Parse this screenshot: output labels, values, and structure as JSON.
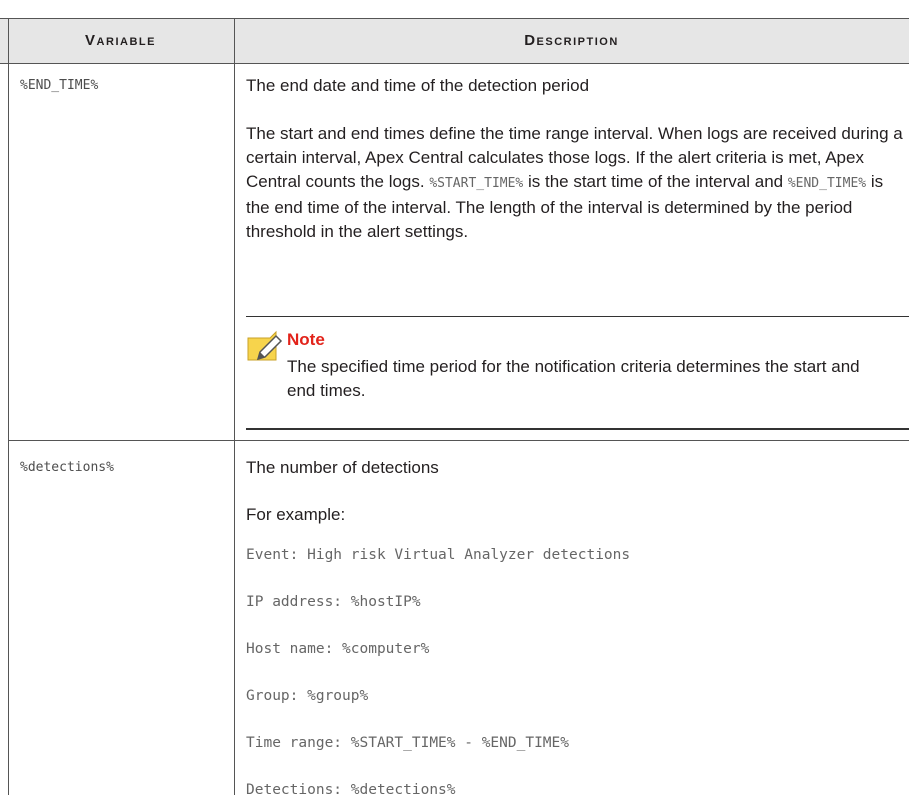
{
  "table": {
    "headers": {
      "variable": "Variable",
      "description": "Description"
    },
    "rows": [
      {
        "variable": "%END_TIME%",
        "line1": "The end date and time of the detection period",
        "para_a": "The start and end times define the time range interval. When logs are received during a certain interval, Apex Central calculates those logs. If the alert criteria is met, Apex Central counts the logs. ",
        "code_a": "%START_TIME%",
        "para_b": " is the start time of the interval and ",
        "code_b": "%END_TIME%",
        "para_c": " is the end time of the interval. The length of the interval is determined by the period threshold in the alert settings.",
        "note": {
          "icon": "note-pencil-icon",
          "title": "Note",
          "body": "The specified time period for the notification criteria determines the start and end times."
        }
      },
      {
        "variable": "%detections%",
        "line1": "The number of detections",
        "line2": "For example:",
        "examples": [
          "Event: High risk Virtual Analyzer detections",
          "IP address: %hostIP%",
          "Host name: %computer%",
          "Group: %group%",
          "Time range: %START_TIME% - %END_TIME%",
          "Detections: %detections%"
        ]
      }
    ]
  },
  "colors": {
    "header_bg": "#e6e6e6",
    "note_title": "#e2231a",
    "note_icon": "#f7d44c"
  }
}
